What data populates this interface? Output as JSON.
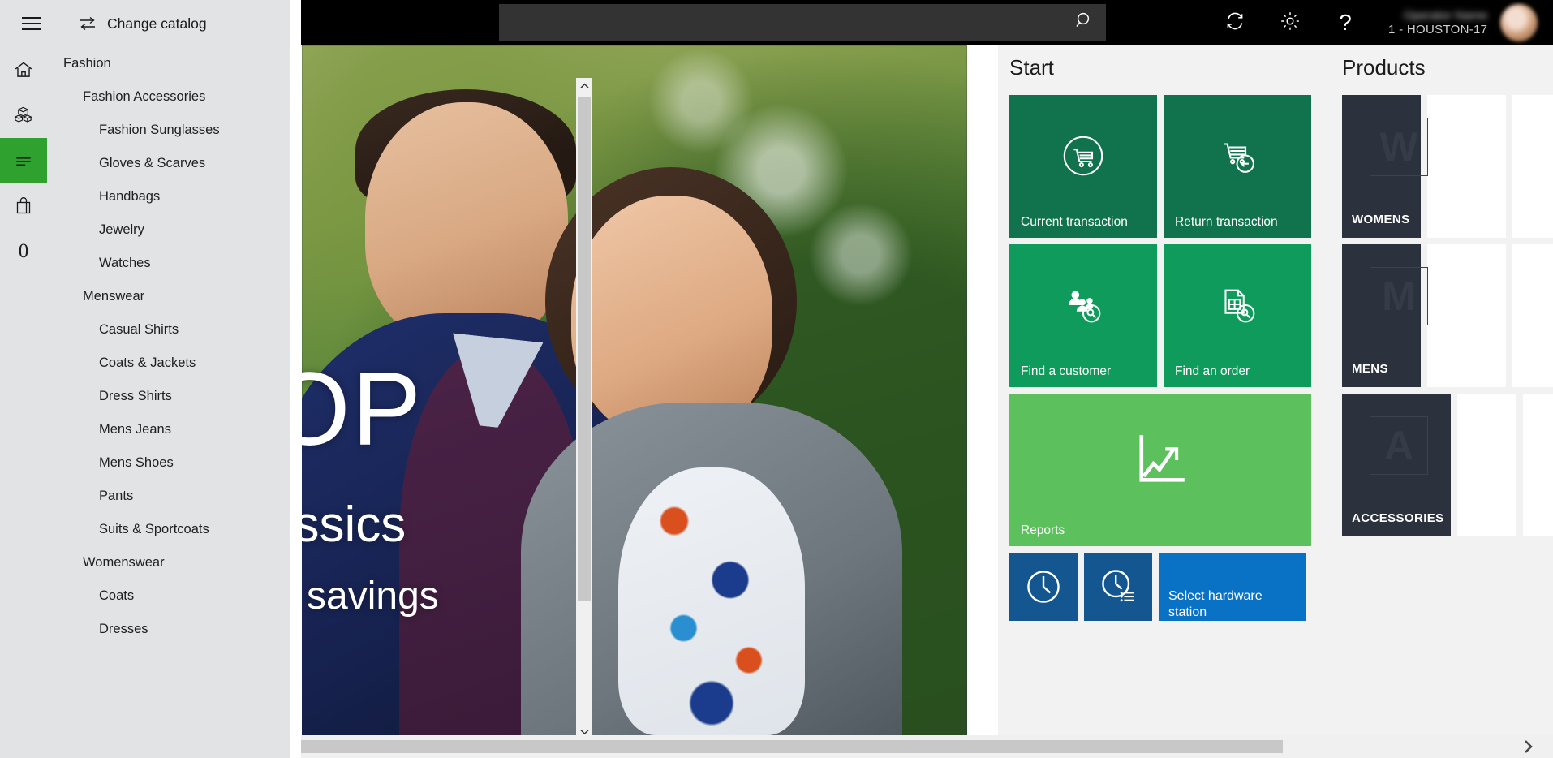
{
  "topbar": {
    "search_placeholder": "",
    "search_value": "",
    "search_icon": "search-icon",
    "refresh_icon": "refresh-icon",
    "settings_icon": "gear-icon",
    "help_icon": "question-mark-icon",
    "user_name": "Operator Name",
    "user_store": "1 - HOUSTON-17",
    "avatar": "user-avatar"
  },
  "sidebar": {
    "menu_label": "hamburger-menu",
    "change_catalog": "Change catalog",
    "swap_icon": "swap-arrows-icon",
    "rail": [
      {
        "icon": "home-icon",
        "name": "home",
        "active": false
      },
      {
        "icon": "products-boxes-icon",
        "name": "products",
        "active": false
      },
      {
        "icon": "catalog-list-icon",
        "name": "catalog",
        "active": true
      },
      {
        "icon": "shopping-bag-icon",
        "name": "cart",
        "active": false
      },
      {
        "icon": "zero-count",
        "name": "count",
        "active": false,
        "glyph": "0"
      }
    ],
    "catalog": [
      {
        "label": "Fashion",
        "level": 0
      },
      {
        "label": "Fashion Accessories",
        "level": 1
      },
      {
        "label": "Fashion Sunglasses",
        "level": 2
      },
      {
        "label": "Gloves & Scarves",
        "level": 2
      },
      {
        "label": "Handbags",
        "level": 2
      },
      {
        "label": "Jewelry",
        "level": 2
      },
      {
        "label": "Watches",
        "level": 2
      },
      {
        "label": "Menswear",
        "level": 1
      },
      {
        "label": "Casual Shirts",
        "level": 2
      },
      {
        "label": "Coats & Jackets",
        "level": 2
      },
      {
        "label": "Dress Shirts",
        "level": 2
      },
      {
        "label": "Mens Jeans",
        "level": 2
      },
      {
        "label": "Mens Shoes",
        "level": 2
      },
      {
        "label": "Pants",
        "level": 2
      },
      {
        "label": "Suits & Sportcoats",
        "level": 2
      },
      {
        "label": "Womenswear",
        "level": 1
      },
      {
        "label": "Coats",
        "level": 2
      },
      {
        "label": "Dresses",
        "level": 2
      }
    ]
  },
  "hero": {
    "line1": "OP",
    "line2": "assics",
    "line3": "e savings",
    "alt": "promotional-banner-couple-outdoors"
  },
  "start": {
    "title": "Start",
    "tiles": [
      {
        "label": "Current transaction",
        "icon": "cart-circle-icon",
        "color": "#11734d",
        "size": "md"
      },
      {
        "label": "Return transaction",
        "icon": "cart-return-icon",
        "color": "#11734d",
        "size": "md"
      },
      {
        "label": "Find a customer",
        "icon": "customer-search-icon",
        "color": "#0f9b5c",
        "size": "md"
      },
      {
        "label": "Find an order",
        "icon": "order-search-icon",
        "color": "#0f9b5c",
        "size": "md"
      },
      {
        "label": "Reports",
        "icon": "chart-growth-icon",
        "color": "#5cc15c",
        "size": "wide"
      },
      {
        "label": "",
        "icon": "clock-icon",
        "color": "#14568f",
        "size": "sm"
      },
      {
        "label": "",
        "icon": "clock-list-icon",
        "color": "#14568f",
        "size": "sm"
      },
      {
        "label": "Select hardware station",
        "icon": "",
        "color": "#0a72c5",
        "size": "hw"
      }
    ]
  },
  "products": {
    "title": "Products",
    "tiles": [
      {
        "label": "WOMENS",
        "placeholder": "W"
      },
      {
        "label": "MENS",
        "placeholder": "M"
      },
      {
        "label": "ACCESSORIES",
        "placeholder": "A"
      }
    ]
  },
  "scroll": {
    "up_arrow": "chevron-up-icon",
    "down_arrow": "chevron-down-icon",
    "right_arrow": "chevron-right-icon"
  },
  "colors": {
    "tile_dark_green": "#11734d",
    "tile_mid_green": "#0f9b5c",
    "tile_light_green": "#5cc15c",
    "tile_dark_blue": "#14568f",
    "tile_bright_blue": "#0a72c5",
    "accent_green": "#2fa12f",
    "panel_bg": "#f2f2f2",
    "sidebar_bg": "#e1e3e5",
    "topbar_bg": "#000000",
    "product_tile_bg": "#2b313d"
  }
}
